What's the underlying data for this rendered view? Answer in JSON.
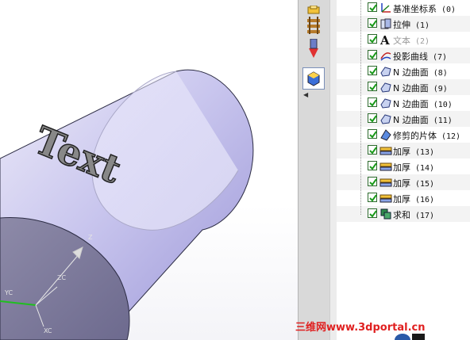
{
  "viewport": {
    "text_feature": "Text",
    "axes": {
      "z": "Z",
      "zc": "ZC",
      "yc": "YC",
      "xc": "XC"
    }
  },
  "toolstrip": {
    "tools": [
      {
        "name": "assembly-tool-icon"
      },
      {
        "name": "part-navigator-icon"
      },
      {
        "name": "reuse-library-icon"
      },
      {
        "name": "roles-icon"
      }
    ]
  },
  "tree": {
    "items": [
      {
        "label": "基准坐标系",
        "num": "(0)",
        "icon": "datum-csys-icon",
        "muted": false
      },
      {
        "label": "拉伸",
        "num": "(1)",
        "icon": "extrude-icon",
        "muted": false
      },
      {
        "label": "文本",
        "num": "(2)",
        "icon": "text-icon",
        "muted": true
      },
      {
        "label": "投影曲线",
        "num": "(7)",
        "icon": "project-curve-icon",
        "muted": false
      },
      {
        "label": "N 边曲面",
        "num": "(8)",
        "icon": "n-sided-surface-icon",
        "muted": false
      },
      {
        "label": "N 边曲面",
        "num": "(9)",
        "icon": "n-sided-surface-icon",
        "muted": false
      },
      {
        "label": "N 边曲面",
        "num": "(10)",
        "icon": "n-sided-surface-icon",
        "muted": false
      },
      {
        "label": "N 边曲面",
        "num": "(11)",
        "icon": "n-sided-surface-icon",
        "muted": false
      },
      {
        "label": "修剪的片体",
        "num": "(12)",
        "icon": "trimmed-sheet-icon",
        "muted": false
      },
      {
        "label": "加厚",
        "num": "(13)",
        "icon": "thicken-icon",
        "muted": false
      },
      {
        "label": "加厚",
        "num": "(14)",
        "icon": "thicken-icon",
        "muted": false
      },
      {
        "label": "加厚",
        "num": "(15)",
        "icon": "thicken-icon",
        "muted": false
      },
      {
        "label": "加厚",
        "num": "(16)",
        "icon": "thicken-icon",
        "muted": false
      },
      {
        "label": "求和",
        "num": "(17)",
        "icon": "unite-icon",
        "muted": false
      }
    ]
  },
  "watermark": "三维网www.3dportal.cn"
}
